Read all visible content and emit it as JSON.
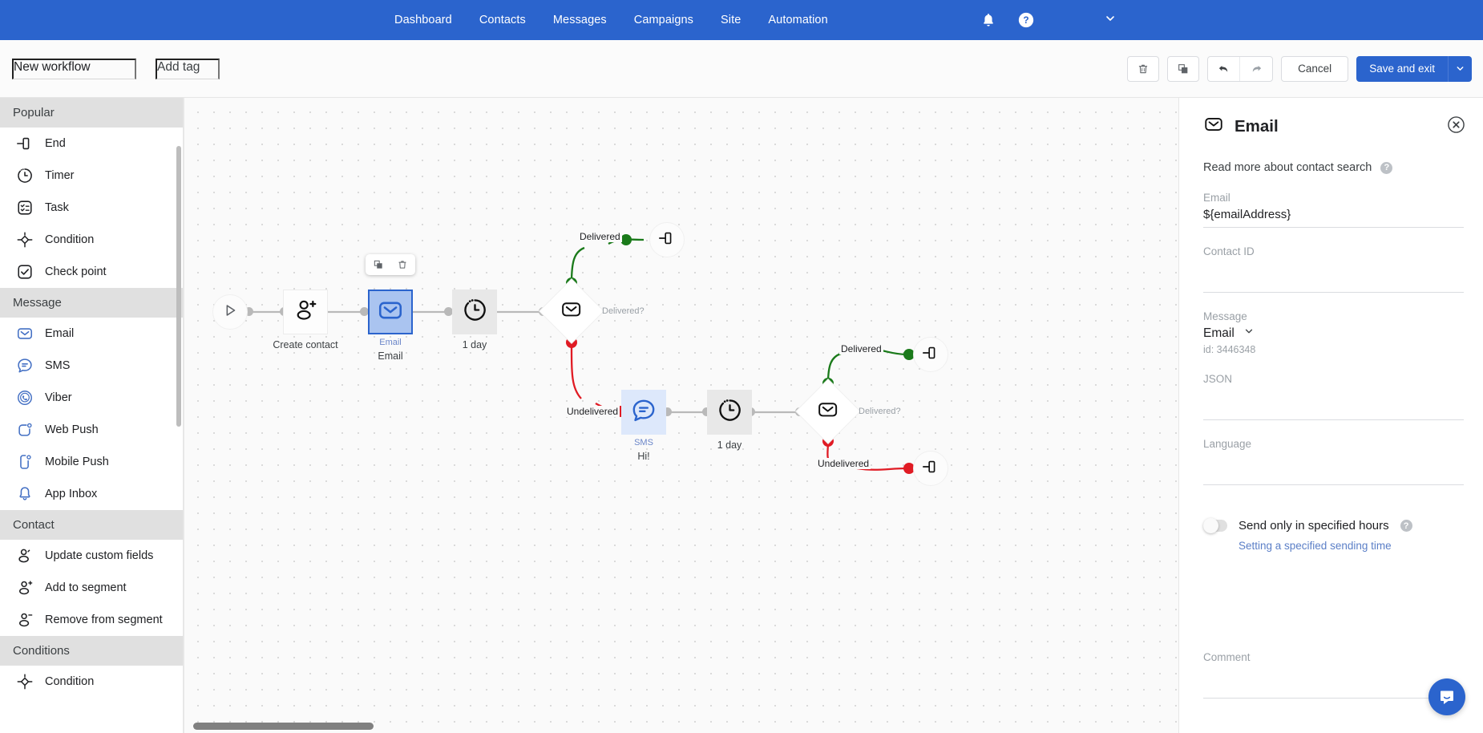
{
  "topnav": {
    "links": [
      {
        "label": "Dashboard"
      },
      {
        "label": "Contacts"
      },
      {
        "label": "Messages"
      },
      {
        "label": "Campaigns"
      },
      {
        "label": "Site"
      },
      {
        "label": "Automation"
      }
    ],
    "bell_icon": "bell-icon",
    "help_icon": "help-circle-icon",
    "account_caret_icon": "chevron-down-icon",
    "background_color": "#2b64cd"
  },
  "toolbar": {
    "workflow_name": "New workflow",
    "workflow_name_placeholder": "New workflow",
    "tag": "Add tag",
    "tag_placeholder": "Add tag",
    "delete_icon": "trash-icon",
    "copy_icon": "copy-icon",
    "undo_icon": "undo-arrow-icon",
    "redo_icon": "redo-arrow-icon",
    "cancel_label": "Cancel",
    "save_label": "Save and exit",
    "save_caret_icon": "chevron-down-icon",
    "accent_color": "#2b64cd"
  },
  "sidebar": {
    "sections": [
      {
        "title": "Popular",
        "items": [
          {
            "label": "End",
            "icon": "end-node-icon"
          },
          {
            "label": "Timer",
            "icon": "timer-icon"
          },
          {
            "label": "Task",
            "icon": "task-checklist-icon"
          },
          {
            "label": "Condition",
            "icon": "condition-diamond-icon"
          },
          {
            "label": "Check point",
            "icon": "check-point-icon"
          }
        ]
      },
      {
        "title": "Message",
        "items": [
          {
            "label": "Email",
            "icon": "email-envelope-icon"
          },
          {
            "label": "SMS",
            "icon": "sms-bubble-icon"
          },
          {
            "label": "Viber",
            "icon": "viber-icon"
          },
          {
            "label": "Web Push",
            "icon": "web-push-icon"
          },
          {
            "label": "Mobile Push",
            "icon": "mobile-push-icon"
          },
          {
            "label": "App Inbox",
            "icon": "app-inbox-bell-icon"
          }
        ]
      },
      {
        "title": "Contact",
        "items": [
          {
            "label": "Update custom fields",
            "icon": "user-edit-icon"
          },
          {
            "label": "Add to segment",
            "icon": "user-add-icon"
          },
          {
            "label": "Remove from segment",
            "icon": "user-remove-icon"
          }
        ]
      },
      {
        "title": "Conditions",
        "items": [
          {
            "label": "Condition",
            "icon": "condition-diamond-icon"
          }
        ]
      }
    ]
  },
  "canvas": {
    "float_toolbar": {
      "copy_icon": "copy-icon",
      "delete_icon": "trash-icon"
    },
    "nodes": [
      {
        "id": "start",
        "type": "start",
        "label": "",
        "icon": "play-triangle-icon"
      },
      {
        "id": "create_contact",
        "type": "square",
        "label": "Create contact",
        "icon": "user-add-icon"
      },
      {
        "id": "email1",
        "type": "square-selected",
        "label": "Email",
        "sublabel": "Email",
        "icon": "email-envelope-icon"
      },
      {
        "id": "timer1",
        "type": "square-grey",
        "label": "1 day",
        "icon": "timer-icon"
      },
      {
        "id": "cond1",
        "type": "diamond",
        "label": "Delivered?",
        "icon": "email-envelope-icon"
      },
      {
        "id": "end1",
        "type": "end",
        "label": "",
        "icon": "end-node-icon"
      },
      {
        "id": "sms1",
        "type": "square-sms",
        "label": "Hi!",
        "sublabel": "SMS",
        "icon": "sms-bubble-icon"
      },
      {
        "id": "timer2",
        "type": "square-grey",
        "label": "1 day",
        "icon": "timer-icon"
      },
      {
        "id": "cond2",
        "type": "diamond",
        "label": "Delivered?",
        "icon": "email-envelope-icon"
      },
      {
        "id": "end2",
        "type": "end",
        "label": "",
        "icon": "end-node-icon"
      },
      {
        "id": "end3",
        "type": "end",
        "label": "",
        "icon": "end-node-icon"
      }
    ],
    "edge_labels": {
      "delivered_1": "Delivered",
      "undelivered_1": "Undelivered",
      "delivered_2": "Delivered",
      "undelivered_2": "Undelivered"
    },
    "colors": {
      "delivered": "#1a7a1a",
      "undelivered": "#e01b24",
      "edge": "#b9b9b9"
    }
  },
  "panel": {
    "icon": "email-envelope-icon",
    "title": "Email",
    "close_icon": "close-circle-icon",
    "read_more_text": "Read more about contact search",
    "help_icon": "help-circle-icon",
    "fields": {
      "email_label": "Email",
      "email_value": "${emailAddress}",
      "contact_id_label": "Contact ID",
      "contact_id_value": "",
      "message_label": "Message",
      "message_value": "Email",
      "message_caret_icon": "chevron-down-icon",
      "message_id": "id: 3446348",
      "json_label": "JSON",
      "json_value": "",
      "language_label": "Language",
      "language_value": "",
      "comment_label": "Comment",
      "comment_value": ""
    },
    "toggle": {
      "label": "Send only in specified hours",
      "state": "off",
      "help_icon": "help-circle-icon",
      "sub_link": "Setting a specified sending time"
    },
    "intercom_icon": "chat-bubble-icon"
  }
}
